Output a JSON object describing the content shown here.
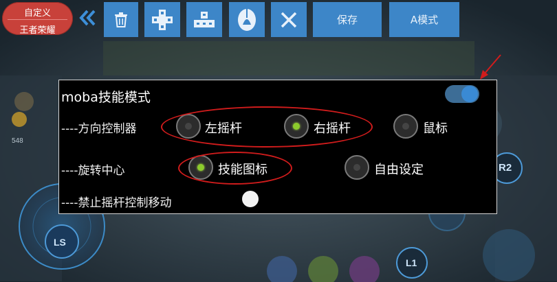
{
  "toolbar": {
    "preset_top": "自定义",
    "preset_bottom": "王者荣耀",
    "save_label": "保存",
    "mode_label": "A模式",
    "icons": [
      "double-chevron-left-icon",
      "trash-icon",
      "dpad-icon",
      "dpad-compact-icon",
      "mouse-icon",
      "close-icon"
    ]
  },
  "hud": {
    "ls_label": "LS",
    "r2_label": "R2",
    "l1_label": "L1",
    "gold_value": "548"
  },
  "dialog": {
    "title": "moba技能模式",
    "toggle_on": true,
    "direction": {
      "label": "----方向控制器",
      "options": [
        {
          "label": "左摇杆",
          "checked": false
        },
        {
          "label": "右摇杆",
          "checked": true
        },
        {
          "label": "鼠标",
          "checked": false
        }
      ]
    },
    "rotation": {
      "label": "----旋转中心",
      "options": [
        {
          "label": "技能图标",
          "checked": true
        },
        {
          "label": "自由设定",
          "checked": false
        }
      ]
    },
    "disable_move": {
      "label": "----禁止摇杆控制移动",
      "checked": false
    }
  },
  "colors": {
    "accent_blue": "#3d86c8",
    "preset_red": "#c8413a",
    "annotation_red": "#d11c1c",
    "radio_green": "#8ccb2c"
  }
}
